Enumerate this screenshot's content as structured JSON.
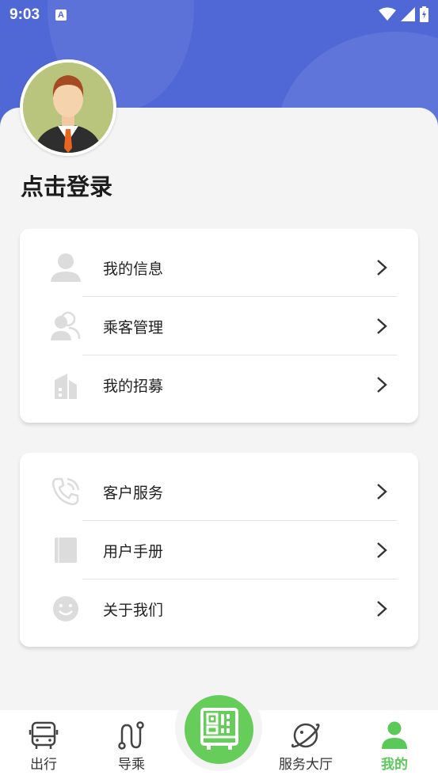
{
  "status_bar": {
    "time": "9:03",
    "badge": "A"
  },
  "profile": {
    "login_label": "点击登录",
    "avatar_icon": "user-avatar"
  },
  "menu_group_1": [
    {
      "label": "我的信息",
      "icon": "person-icon"
    },
    {
      "label": "乘客管理",
      "icon": "passengers-icon"
    },
    {
      "label": "我的招募",
      "icon": "building-icon"
    }
  ],
  "menu_group_2": [
    {
      "label": "客户服务",
      "icon": "phone-icon"
    },
    {
      "label": "用户手册",
      "icon": "manual-icon"
    },
    {
      "label": "关于我们",
      "icon": "smile-icon"
    }
  ],
  "bottom_nav": {
    "items": [
      {
        "label": "出行",
        "icon": "bus-icon"
      },
      {
        "label": "导乘",
        "icon": "route-icon"
      },
      {
        "label": "服务大厅",
        "icon": "planet-icon"
      },
      {
        "label": "我的",
        "icon": "person-icon",
        "active": true
      }
    ],
    "center_icon": "qr-bus-icon"
  },
  "colors": {
    "header": "#5068d6",
    "accent": "#5bc95a",
    "icon_gray": "#dcdcdc"
  }
}
